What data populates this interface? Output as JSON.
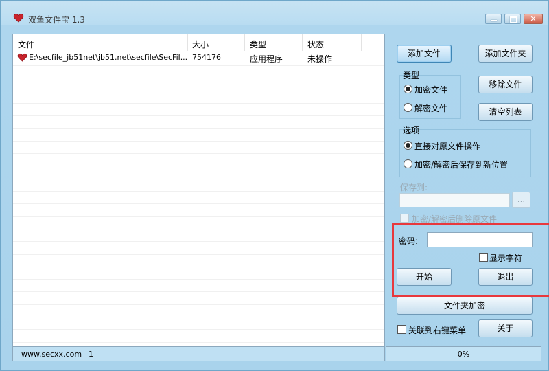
{
  "window": {
    "title": "双鱼文件宝 1.3"
  },
  "file_list": {
    "columns": [
      "文件",
      "大小",
      "类型",
      "状态"
    ],
    "rows": [
      {
        "file": "E:\\secfile_jb51net\\jb51.net\\secfile\\SecFil...",
        "size": "754176",
        "type": "应用程序",
        "status": "未操作"
      }
    ]
  },
  "buttons": {
    "add_file": "添加文件",
    "add_folder": "添加文件夹",
    "remove_file": "移除文件",
    "clear_list": "清空列表",
    "start": "开始",
    "exit": "退出",
    "folder_encrypt": "文件夹加密",
    "about": "关于",
    "browse": "..."
  },
  "type_group": {
    "label": "类型",
    "options": [
      "加密文件",
      "解密文件"
    ],
    "selected": "加密文件"
  },
  "options_group": {
    "label": "选项",
    "options": [
      "直接对原文件操作",
      "加密/解密后保存到新位置"
    ],
    "selected": "直接对原文件操作"
  },
  "save_to": {
    "label": "保存到:",
    "value": ""
  },
  "delete_original": {
    "label": "加密/解密后删除原文件",
    "checked": false
  },
  "password": {
    "label": "密码:",
    "value": ""
  },
  "show_chars": {
    "label": "显示字符",
    "checked": false
  },
  "context_menu": {
    "label": "关联到右键菜单",
    "checked": false
  },
  "status_bar": {
    "site": "www.secxx.com",
    "count": "1",
    "progress": "0%"
  },
  "colors": {
    "highlight": "#e8383d",
    "window_bg": "#a9d3ec"
  }
}
